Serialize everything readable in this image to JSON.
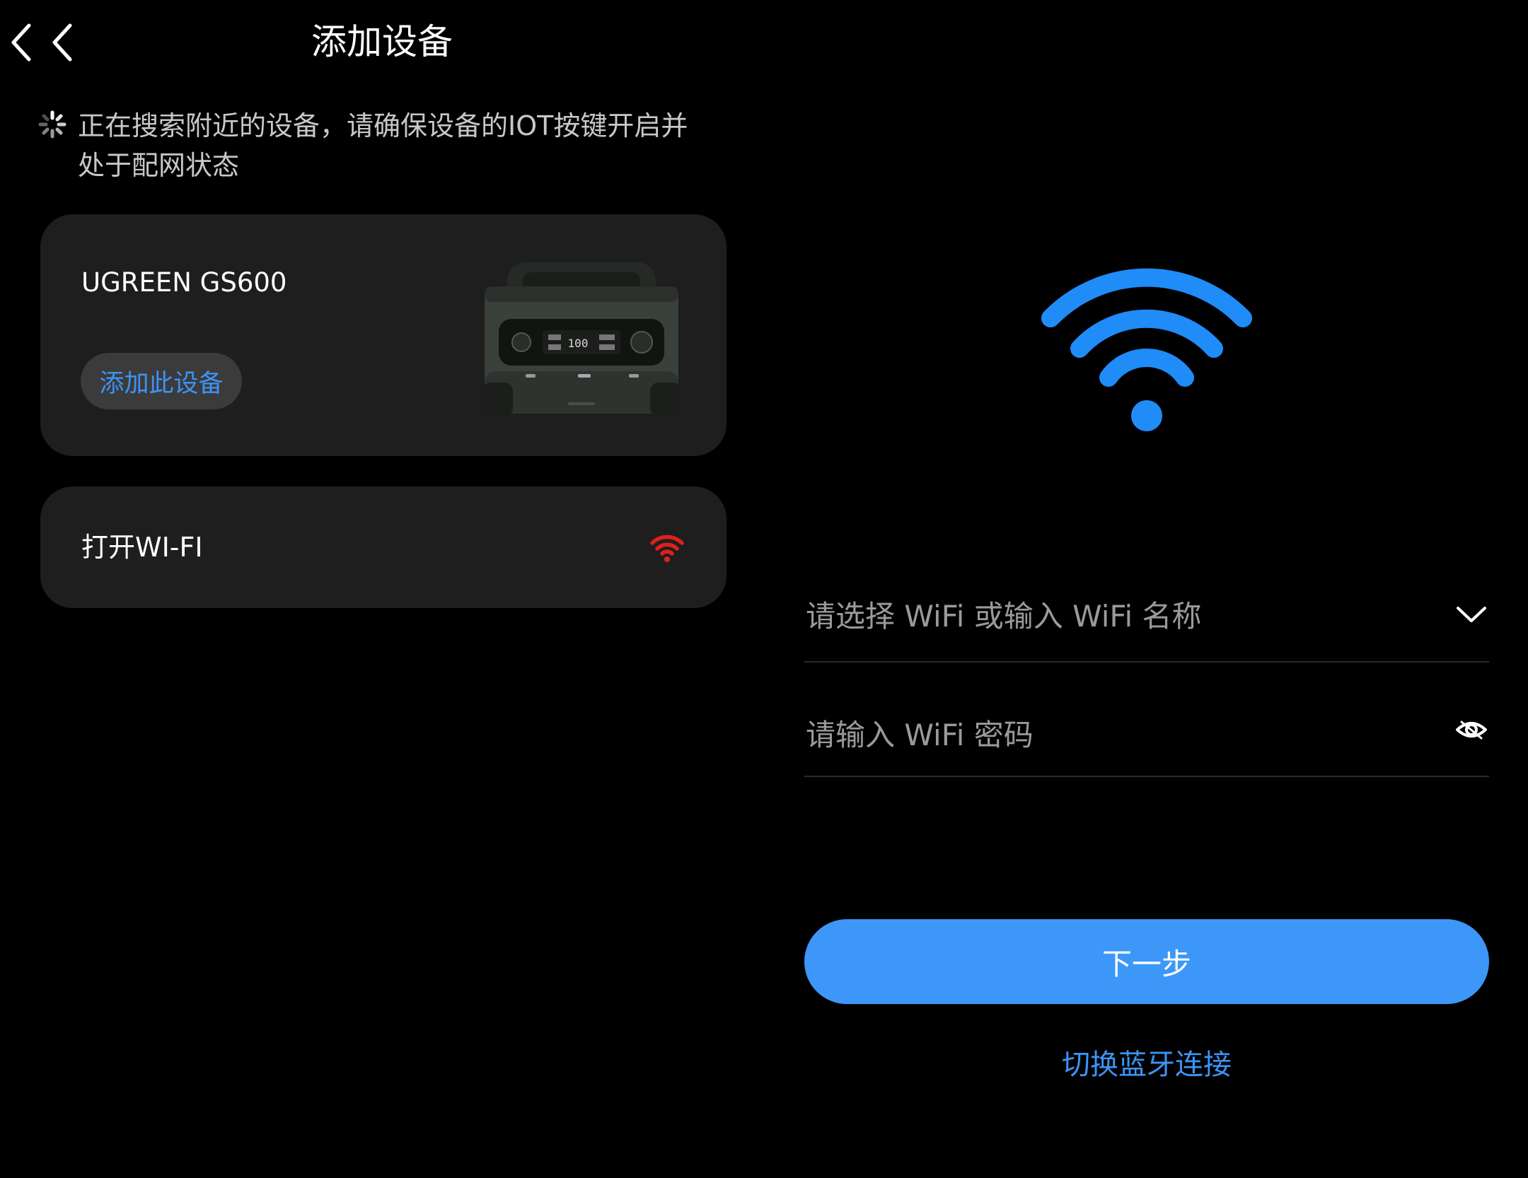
{
  "left_screen": {
    "header": {
      "title": "添加设备",
      "back_icon": "chevron-left-icon"
    },
    "search_hint": {
      "icon": "loading-spinner-icon",
      "text": "正在搜索附近的设备，请确保设备的IOT按键开启并处于配网状态"
    },
    "device_card": {
      "name": "UGREEN GS600",
      "add_button_label": "添加此设备",
      "device_image": "portable-power-station",
      "device_display_value": "100"
    },
    "wifi_card": {
      "label": "打开WI-FI",
      "icon": "wifi-off-red-icon"
    }
  },
  "right_screen": {
    "header": {
      "back_icon": "chevron-left-icon"
    },
    "wifi_icon": "wifi-icon",
    "ssid_field": {
      "placeholder": "请选择 WiFi 或输入 WiFi 名称",
      "value": "",
      "dropdown_icon": "chevron-down-icon"
    },
    "password_field": {
      "placeholder": "请输入 WiFi 密码",
      "value": "",
      "visibility_icon": "eye-icon"
    },
    "next_button_label": "下一步",
    "switch_link_label": "切换蓝牙连接"
  },
  "colors": {
    "background": "#000000",
    "card": "#1e1e1e",
    "accent_blue": "#3d97f8",
    "link_blue": "#3d93f5",
    "wifi_blue": "#1f8cf7",
    "wifi_red": "#e0201b",
    "placeholder": "#9a9a9a"
  }
}
